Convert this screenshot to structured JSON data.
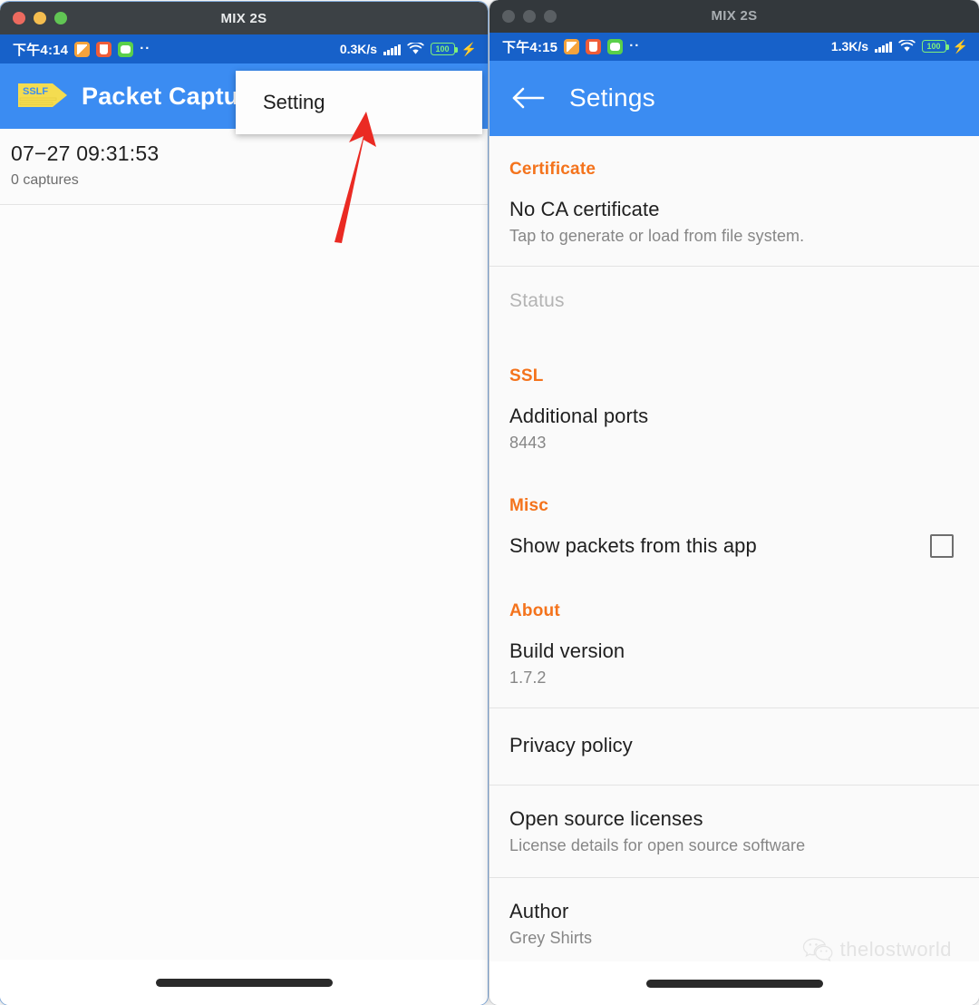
{
  "left_window": {
    "window_title": "MIX 2S",
    "status_bar": {
      "clock": "下午4:14",
      "network_speed": "0.3K/s",
      "battery_level": "100",
      "app_icons": [
        "note-app-icon",
        "alarm-app-icon",
        "android-app-icon"
      ],
      "overflow": "··"
    },
    "app_bar": {
      "logo": "sslf-arrow-logo",
      "logo_text": "SSLF",
      "title": "Packet Capture"
    },
    "popup_menu": {
      "items": [
        {
          "label": "Setting"
        }
      ]
    },
    "captures": [
      {
        "title": "07−27 09:31:53",
        "subtitle": "0 captures"
      }
    ],
    "annotation": {
      "arrow_color": "#ea2a23",
      "points_to": "Setting"
    }
  },
  "right_window": {
    "window_title": "MIX 2S",
    "status_bar": {
      "clock": "下午4:15",
      "network_speed": "1.3K/s",
      "battery_level": "100",
      "app_icons": [
        "note-app-icon",
        "alarm-app-icon",
        "android-app-icon"
      ],
      "overflow": "··"
    },
    "app_bar": {
      "back_icon": "back-arrow-icon",
      "title": "Setings"
    },
    "sections": [
      {
        "header": "Certificate",
        "header_style": "accent",
        "rows": [
          {
            "title": "No CA certificate",
            "subtitle": "Tap to generate or load from file system.",
            "control": "none"
          }
        ],
        "divider_after": true
      },
      {
        "header": "Status",
        "header_style": "muted",
        "rows": [],
        "divider_after": false
      },
      {
        "header": "SSL",
        "header_style": "accent",
        "rows": [
          {
            "title": "Additional ports",
            "subtitle": "8443",
            "control": "none"
          }
        ],
        "divider_after": false
      },
      {
        "header": "Misc",
        "header_style": "accent",
        "rows": [
          {
            "title": "Show packets from this app",
            "subtitle": "",
            "control": "checkbox",
            "checked": false
          }
        ],
        "divider_after": false
      },
      {
        "header": "About",
        "header_style": "accent",
        "rows": [
          {
            "title": "Build version",
            "subtitle": "1.7.2",
            "control": "none"
          }
        ],
        "divider_after": true
      },
      {
        "header": "",
        "header_style": "none",
        "rows": [
          {
            "title": "Privacy policy",
            "subtitle": "",
            "control": "none"
          }
        ],
        "divider_after": true
      },
      {
        "header": "",
        "header_style": "none",
        "rows": [
          {
            "title": "Open source licenses",
            "subtitle": "License details for open source software",
            "control": "none"
          }
        ],
        "divider_after": true
      },
      {
        "header": "",
        "header_style": "none",
        "rows": [
          {
            "title": "Author",
            "subtitle": "Grey Shirts",
            "control": "none"
          }
        ],
        "divider_after": true
      }
    ]
  },
  "watermark": {
    "icon": "wechat-icon",
    "text": "thelostworld"
  },
  "colors": {
    "accent_orange": "#f4731c",
    "appbar_blue": "#3b8cf2",
    "statusbar_blue": "#1761c9",
    "arrow_red": "#ea2a23",
    "logo_yellow": "#f4dc50"
  }
}
